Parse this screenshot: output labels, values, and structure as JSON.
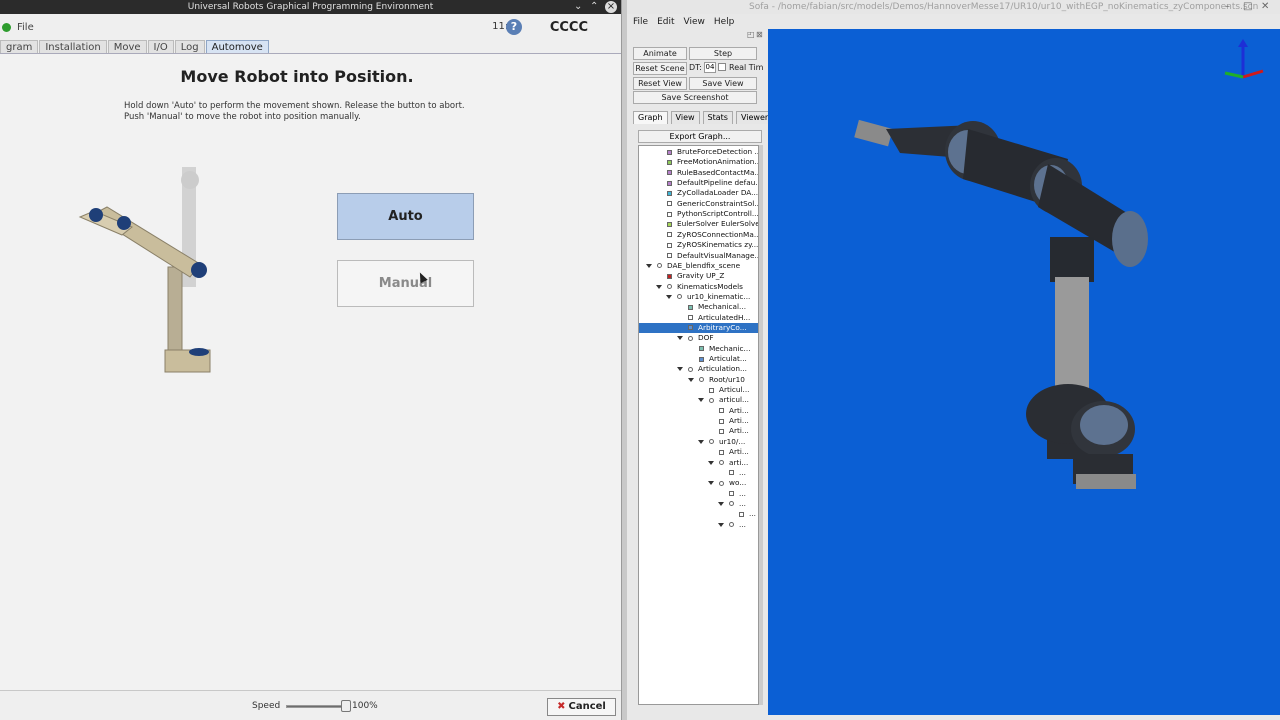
{
  "left_window": {
    "title": "Universal Robots Graphical Programming Environment",
    "menu": {
      "file": "File"
    },
    "clock": "11:15",
    "help_label": "?",
    "robot_name": "CCCC",
    "tabs": [
      "gram",
      "Installation",
      "Move",
      "I/O",
      "Log",
      "Automove"
    ],
    "heading": "Move Robot into Position.",
    "instruction_1": "Hold down 'Auto' to perform the movement shown. Release the button to abort.",
    "instruction_2": "Push 'Manual' to move the robot into position manually.",
    "auto_label": "Auto",
    "manual_label": "Manual",
    "speed_label": "Speed",
    "speed_value": "100%",
    "speed_fraction": 1.0,
    "cancel_label": "Cancel",
    "window_controls": {
      "minimize": "⌄",
      "maximize": "⌃",
      "close": "×"
    }
  },
  "right_window": {
    "title": "Sofa - /home/fabian/src/models/Demos/HannoverMesse17/UR10/ur10_withEGP_noKinematics_zyComponents.scn",
    "menu": [
      "File",
      "Edit",
      "View",
      "Help"
    ],
    "buttons": {
      "animate": "Animate",
      "step": "Step",
      "reset_scene": "Reset Scene",
      "dt_label": "DT:",
      "dt_value": "04",
      "real_time": "Real Tim",
      "reset_view": "Reset View",
      "save_view": "Save View",
      "save_screenshot": "Save Screenshot",
      "export_graph": "Export Graph..."
    },
    "tabs": [
      "Graph",
      "View",
      "Stats",
      "Viewer"
    ],
    "tree": [
      "BruteForceDetection ...",
      "FreeMotionAnimation...",
      "RuleBasedContactMa...",
      "DefaultPipeline defau...",
      "ZyColladaLoader DA...",
      "GenericConstraintSol...",
      "PythonScriptControll...",
      "EulerSolver EulerSolver",
      "ZyROSConnectionMa...",
      "ZyROSKinematics zy...",
      "DefaultVisualManage...",
      "DAE_blendfix_scene",
      "Gravity UP_Z",
      "KinematicsModels",
      "ur10_kinematic...",
      "Mechanical...",
      "ArticulatedH...",
      "ArbitraryCo...",
      "DOF",
      "Mechanic...",
      "Articulat...",
      "Articulation...",
      "Root/ur10",
      "Articul...",
      "articul...",
      "Arti...",
      "Arti...",
      "Arti...",
      "ur10/...",
      "Arti...",
      "arti...",
      "...",
      "wo...",
      "...",
      "...",
      "...",
      "..."
    ],
    "dock_controls": [
      "◰",
      "⊠"
    ]
  },
  "colors": {
    "viewport_bg": "#0b5fd4",
    "auto_btn": "#b8cdea",
    "selected_row": "#2e72c4",
    "robot_dark": "#2b2f36",
    "robot_cap": "#5d7290"
  }
}
